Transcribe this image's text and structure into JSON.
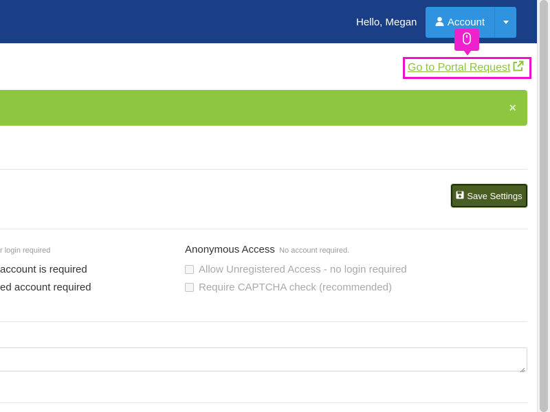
{
  "header": {
    "greeting": "Hello, Megan",
    "account_label": "Account",
    "colors": {
      "bar": "#1a3f87",
      "button": "#2f93e0"
    }
  },
  "portal_link": {
    "label": "Go to Portal Request",
    "icon": "external-link-icon",
    "color": "#8bc540"
  },
  "alert": {
    "close_glyph": "×",
    "color": "#8dc63f"
  },
  "toolbar": {
    "save_label": "Save Settings",
    "icon": "floppy-disk-icon"
  },
  "access": {
    "left_partial_note": "r login required",
    "left_line_1": "account is required",
    "left_line_2": "ed account required",
    "anonymous": {
      "heading": "Anonymous Access",
      "note": "No account required.",
      "options": [
        {
          "label": "Allow Unregistered Access - no login required",
          "checked": false
        },
        {
          "label": "Require CAPTCHA check (recommended)",
          "checked": false
        }
      ]
    }
  }
}
